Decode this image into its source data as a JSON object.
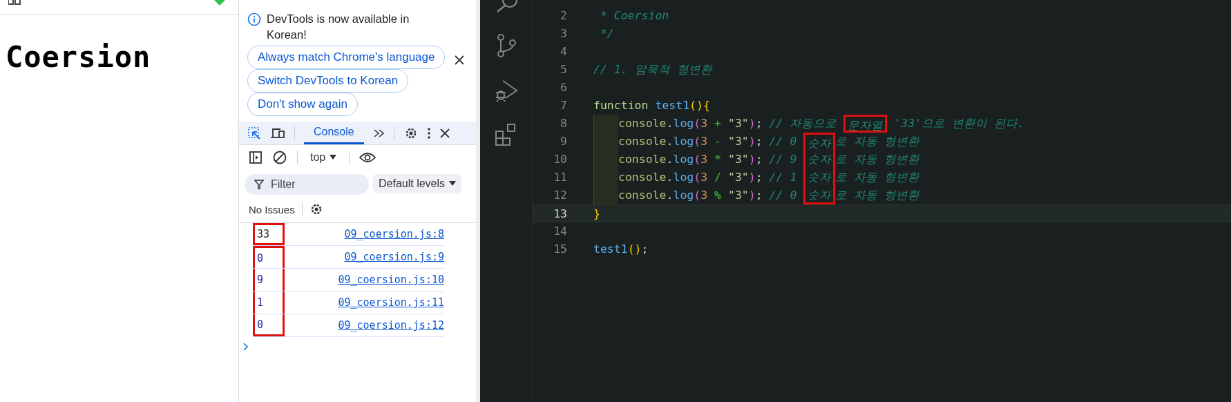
{
  "page": {
    "heading": "Coersion"
  },
  "devtools": {
    "banner": {
      "message": "DevTools is now available in Korean!",
      "buttons": [
        "Always match Chrome's language",
        "Switch DevTools to Korean",
        "Don't show again"
      ]
    },
    "tabs": [
      {
        "label": "Console",
        "selected": true
      }
    ],
    "context": "top",
    "filter": {
      "placeholder": "Filter"
    },
    "levels": "Default levels",
    "issues": "No Issues",
    "messages": [
      {
        "value": "33",
        "source": "09_coersion.js:8",
        "boxed": true,
        "box_joins_next": false
      },
      {
        "value": "0",
        "source": "09_coersion.js:9",
        "boxed": true,
        "box_joins_next": true
      },
      {
        "value": "9",
        "source": "09_coersion.js:10",
        "boxed": true,
        "box_joins_next": true
      },
      {
        "value": "1",
        "source": "09_coersion.js:11",
        "boxed": true,
        "box_joins_next": true
      },
      {
        "value": "0",
        "source": "09_coersion.js:12",
        "boxed": true,
        "box_joins_next": false
      }
    ]
  },
  "code": {
    "lines": [
      {
        "number": "2",
        "current": false,
        "indented": false,
        "tokens": [
          {
            "text": " * Coersion",
            "kind": "comment"
          }
        ]
      },
      {
        "number": "3",
        "current": false,
        "indented": false,
        "tokens": [
          {
            "text": " */",
            "kind": "comment"
          }
        ]
      },
      {
        "number": "4",
        "current": false,
        "indented": false
      },
      {
        "number": "5",
        "current": false,
        "indented": false,
        "tokens": [
          {
            "text": "// 1. 암묵적 형변환",
            "kind": "comment"
          }
        ]
      },
      {
        "number": "6",
        "current": false,
        "indented": false
      },
      {
        "number": "7",
        "current": false,
        "indented": false,
        "tokens": [
          {
            "text": "function ",
            "kind": "keyword"
          },
          {
            "text": "test1",
            "kind": "name"
          },
          {
            "text": "(){",
            "kind": "bracket"
          }
        ]
      },
      {
        "number": "8",
        "current": false,
        "indented": true,
        "tokens": [
          {
            "text": "console",
            "kind": "object"
          },
          {
            "text": ".",
            "kind": "plain"
          },
          {
            "text": "log",
            "kind": "name"
          },
          {
            "text": "(",
            "kind": "bracket2"
          },
          {
            "text": "3",
            "kind": "number"
          },
          {
            "text": " + ",
            "kind": "operator"
          },
          {
            "text": "\"3\"",
            "kind": "string"
          },
          {
            "text": ")",
            "kind": "bracket2"
          },
          {
            "text": ";",
            "kind": "plain"
          },
          {
            "text": " // 자동으로 ",
            "kind": "comment"
          },
          {
            "text": "문자열",
            "kind": "comment",
            "boxed": true,
            "box_joins_next": false
          },
          {
            "text": " '33'으로 변환이 된다.",
            "kind": "comment"
          }
        ]
      },
      {
        "number": "9",
        "current": false,
        "indented": true,
        "tokens": [
          {
            "text": "console",
            "kind": "object"
          },
          {
            "text": ".",
            "kind": "plain"
          },
          {
            "text": "log",
            "kind": "name"
          },
          {
            "text": "(",
            "kind": "bracket2"
          },
          {
            "text": "3",
            "kind": "number"
          },
          {
            "text": " - ",
            "kind": "operator"
          },
          {
            "text": "\"3\"",
            "kind": "string"
          },
          {
            "text": ")",
            "kind": "bracket2"
          },
          {
            "text": ";",
            "kind": "plain"
          },
          {
            "text": " // 0 ",
            "kind": "comment"
          },
          {
            "text": "숫자",
            "kind": "comment",
            "boxed": true,
            "box_joins_next": true
          },
          {
            "text": "로 자동 형변환",
            "kind": "comment"
          }
        ]
      },
      {
        "number": "10",
        "current": false,
        "indented": true,
        "tokens": [
          {
            "text": "console",
            "kind": "object"
          },
          {
            "text": ".",
            "kind": "plain"
          },
          {
            "text": "log",
            "kind": "name"
          },
          {
            "text": "(",
            "kind": "bracket2"
          },
          {
            "text": "3",
            "kind": "number"
          },
          {
            "text": " * ",
            "kind": "operator"
          },
          {
            "text": "\"3\"",
            "kind": "string"
          },
          {
            "text": ")",
            "kind": "bracket2"
          },
          {
            "text": ";",
            "kind": "plain"
          },
          {
            "text": " // 9 ",
            "kind": "comment"
          },
          {
            "text": "숫자",
            "kind": "comment",
            "boxed": true,
            "box_joins_next": true
          },
          {
            "text": "로 자동 형변환",
            "kind": "comment"
          }
        ]
      },
      {
        "number": "11",
        "current": false,
        "indented": true,
        "tokens": [
          {
            "text": "console",
            "kind": "object"
          },
          {
            "text": ".",
            "kind": "plain"
          },
          {
            "text": "log",
            "kind": "name"
          },
          {
            "text": "(",
            "kind": "bracket2"
          },
          {
            "text": "3",
            "kind": "number"
          },
          {
            "text": " / ",
            "kind": "operator"
          },
          {
            "text": "\"3\"",
            "kind": "string"
          },
          {
            "text": ")",
            "kind": "bracket2"
          },
          {
            "text": ";",
            "kind": "plain"
          },
          {
            "text": " // 1 ",
            "kind": "comment"
          },
          {
            "text": "숫자",
            "kind": "comment",
            "boxed": true,
            "box_joins_next": true
          },
          {
            "text": "로 자동 형변환",
            "kind": "comment"
          }
        ]
      },
      {
        "number": "12",
        "current": false,
        "indented": true,
        "tokens": [
          {
            "text": "console",
            "kind": "object"
          },
          {
            "text": ".",
            "kind": "plain"
          },
          {
            "text": "log",
            "kind": "name"
          },
          {
            "text": "(",
            "kind": "bracket2"
          },
          {
            "text": "3",
            "kind": "number"
          },
          {
            "text": " % ",
            "kind": "operator"
          },
          {
            "text": "\"3\"",
            "kind": "string"
          },
          {
            "text": ")",
            "kind": "bracket2"
          },
          {
            "text": ";",
            "kind": "plain"
          },
          {
            "text": " // 0 ",
            "kind": "comment"
          },
          {
            "text": "숫자",
            "kind": "comment",
            "boxed": true,
            "box_joins_next": false
          },
          {
            "text": "로 자동 형변환",
            "kind": "comment"
          }
        ]
      },
      {
        "number": "13",
        "current": true,
        "indented": false,
        "tokens": [
          {
            "text": "}",
            "kind": "bracket"
          }
        ]
      },
      {
        "number": "14",
        "current": false,
        "indented": false
      },
      {
        "number": "15",
        "current": false,
        "indented": false,
        "tokens": [
          {
            "text": "test1",
            "kind": "name"
          },
          {
            "text": "()",
            "kind": "bracket"
          },
          {
            "text": ";",
            "kind": "plain"
          }
        ]
      }
    ]
  }
}
